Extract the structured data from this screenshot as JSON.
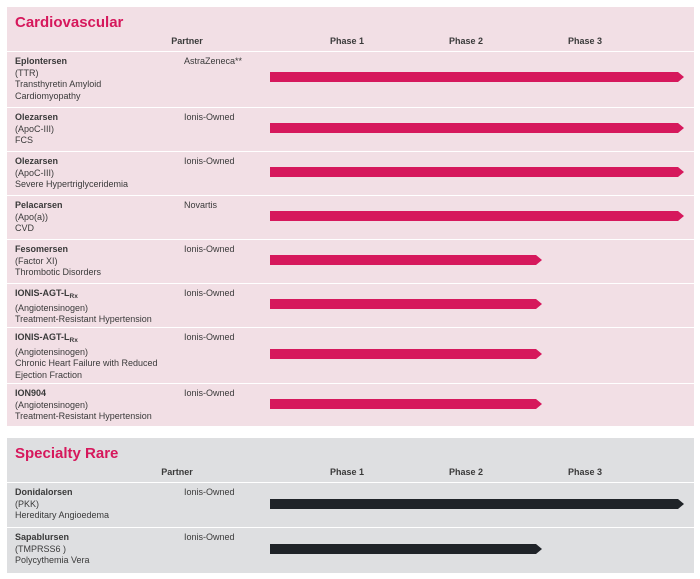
{
  "chart_data": {
    "type": "table",
    "phases": [
      "Phase 1",
      "Phase 2",
      "Phase 3"
    ],
    "partner_header": "Partner",
    "sections": [
      {
        "title": "Cardiovascular",
        "color": "#d6185c",
        "rows": [
          {
            "name": "Eplontersen",
            "sub": "",
            "lines": [
              "(TTR)",
              "Transthyretin Amyloid",
              "Cardiomyopathy"
            ],
            "partner": "AstraZeneca**",
            "phase": 3
          },
          {
            "name": "Olezarsen",
            "sub": "",
            "lines": [
              "(ApoC-III)",
              "FCS"
            ],
            "partner": "Ionis-Owned",
            "phase": 3
          },
          {
            "name": "Olezarsen",
            "sub": "",
            "lines": [
              "(ApoC-III)",
              "Severe Hypertriglyceridemia"
            ],
            "partner": "Ionis-Owned",
            "phase": 3
          },
          {
            "name": "Pelacarsen",
            "sub": "",
            "lines": [
              "(Apo(a))",
              "CVD"
            ],
            "partner": "Novartis",
            "phase": 3
          },
          {
            "name": "Fesomersen",
            "sub": "",
            "lines": [
              "(Factor XI)",
              "Thrombotic Disorders"
            ],
            "partner": "Ionis-Owned",
            "phase": 2
          },
          {
            "name": "IONIS-AGT-L",
            "sub": "Rx",
            "lines": [
              "(Angiotensinogen)",
              "Treatment-Resistant Hypertension"
            ],
            "partner": "Ionis-Owned",
            "phase": 2
          },
          {
            "name": "IONIS-AGT-L",
            "sub": "Rx",
            "lines": [
              "(Angiotensinogen)",
              "Chronic Heart Failure with Reduced",
              "Ejection Fraction"
            ],
            "partner": "Ionis-Owned",
            "phase": 2
          },
          {
            "name": "ION904",
            "sub": "",
            "lines": [
              "(Angiotensinogen)",
              "Treatment-Resistant Hypertension"
            ],
            "partner": "Ionis-Owned",
            "phase": 2
          }
        ]
      },
      {
        "title": "Specialty Rare",
        "color": "#1f2328",
        "rows": [
          {
            "name": "Donidalorsen",
            "sub": "",
            "lines": [
              "(PKK)",
              "Hereditary Angioedema"
            ],
            "partner": "Ionis-Owned",
            "phase": 3
          },
          {
            "name": "Sapablursen",
            "sub": "",
            "lines": [
              "(TMPRSS6 )",
              "Polycythemia Vera"
            ],
            "partner": "Ionis-Owned",
            "phase": 2
          }
        ]
      }
    ]
  }
}
